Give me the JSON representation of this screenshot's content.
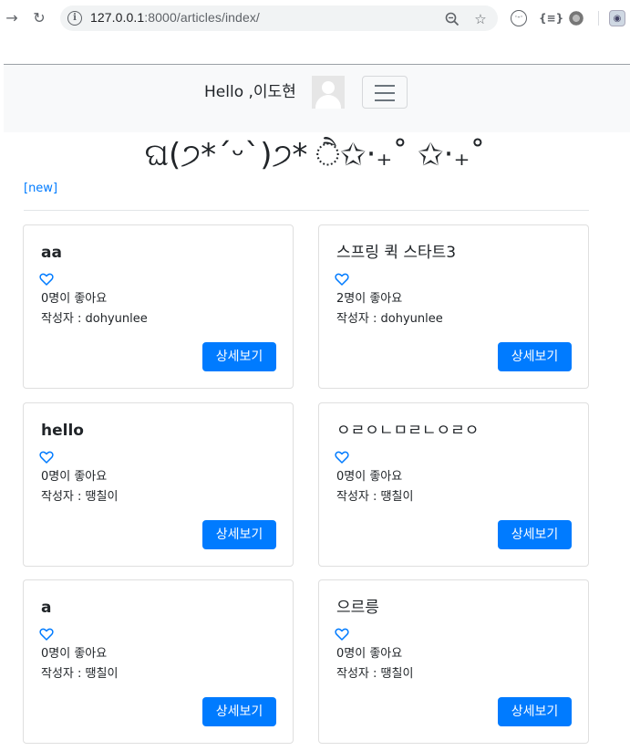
{
  "browser": {
    "url_host": "127.0.0.1",
    "url_rest": ":8000/articles/index/"
  },
  "navbar": {
    "greeting": "Hello ,이도현"
  },
  "page": {
    "banner": "ଘ(੭*ˊᵕˋ)੭* ੈ✩‧₊˚ ✩‧₊˚",
    "new_link": "[new]"
  },
  "accent_color": "#007bff",
  "articles": [
    {
      "title": "aa",
      "likes": "0명이 좋아요",
      "author": "작성자 : dohyunlee",
      "button": "상세보기"
    },
    {
      "title": "스프링 퀵 스타트3",
      "likes": "2명이 좋아요",
      "author": "작성자 : dohyunlee",
      "button": "상세보기"
    },
    {
      "title": "hello",
      "likes": "0명이 좋아요",
      "author": "작성자 : 땡칠이",
      "button": "상세보기"
    },
    {
      "title": "ㅇㄹㅇㄴㅁㄹㄴㅇㄹㅇ",
      "likes": "0명이 좋아요",
      "author": "작성자 : 땡칠이",
      "button": "상세보기"
    },
    {
      "title": "a",
      "likes": "0명이 좋아요",
      "author": "작성자 : 땡칠이",
      "button": "상세보기"
    },
    {
      "title": "으르릉",
      "likes": "0명이 좋아요",
      "author": "작성자 : 땡칠이",
      "button": "상세보기"
    }
  ]
}
